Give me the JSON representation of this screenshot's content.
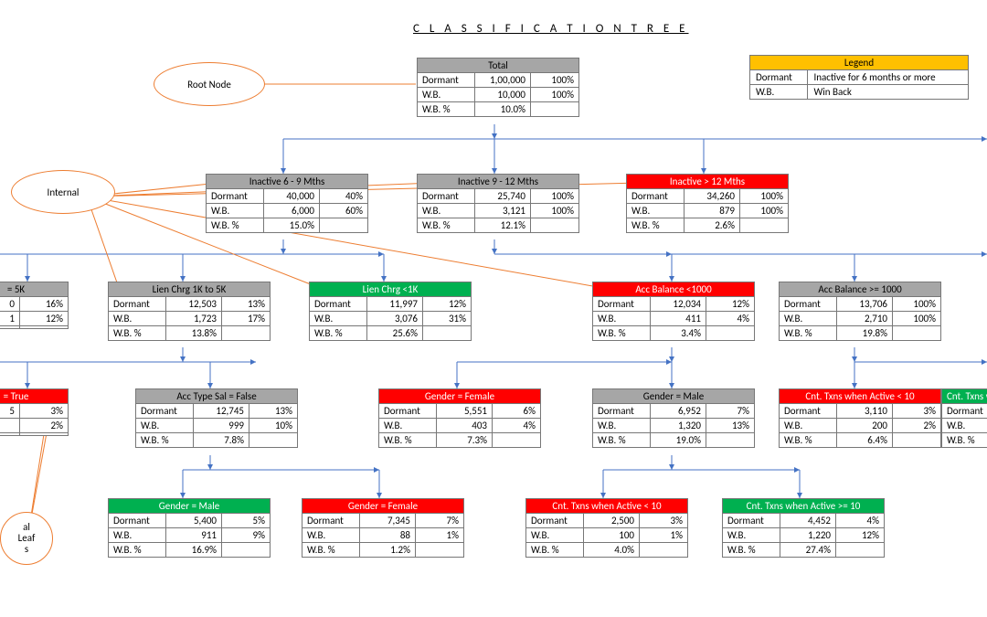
{
  "title": "C L A S S I F I C A T I O N     T R E E",
  "annot": {
    "root": "Root Node",
    "internal": "Internal",
    "leaf_a": "al",
    "leaf_b": "Leaf",
    "leaf_c": "s"
  },
  "legend": {
    "title": "Legend",
    "r1a": "Dormant",
    "r1b": "Inactive for 6 months or more",
    "r2a": "W.B.",
    "r2b": "Win Back"
  },
  "labels": {
    "dormant": "Dormant",
    "wb": "W.B.",
    "wbp": "W.B. %"
  },
  "n": {
    "total": {
      "title": "Total",
      "d": "1,00,000",
      "dp": "100%",
      "w": "10,000",
      "wp": "100%",
      "p": "10.0%"
    },
    "l1a": {
      "title": "Inactive 6 - 9 Mths",
      "d": "40,000",
      "dp": "40%",
      "w": "6,000",
      "wp": "60%",
      "p": "15.0%"
    },
    "l1b": {
      "title": "Inactive 9 - 12 Mths",
      "d": "25,740",
      "dp": "100%",
      "w": "3,121",
      "wp": "100%",
      "p": "12.1%"
    },
    "l1c": {
      "title": "Inactive > 12 Mths",
      "d": "34,260",
      "dp": "100%",
      "w": "879",
      "wp": "100%",
      "p": "2.6%"
    },
    "l2x": {
      "title": "= 5K",
      "d": "0",
      "dp": "16%",
      "w": "1",
      "wp": "12%",
      "p": ""
    },
    "l2a": {
      "title": "Lien Chrg 1K to 5K",
      "d": "12,503",
      "dp": "13%",
      "w": "1,723",
      "wp": "17%",
      "p": "13.8%"
    },
    "l2b": {
      "title": "Lien Chrg <1K",
      "d": "11,997",
      "dp": "12%",
      "w": "3,076",
      "wp": "31%",
      "p": "25.6%"
    },
    "l2c": {
      "title": "Acc Balance <1000",
      "d": "12,034",
      "dp": "12%",
      "w": "411",
      "wp": "4%",
      "p": "3.4%"
    },
    "l2d": {
      "title": "Acc Balance >= 1000",
      "d": "13,706",
      "dp": "100%",
      "w": "2,710",
      "wp": "100%",
      "p": "19.8%"
    },
    "l3x": {
      "title": "= True",
      "d": "5",
      "dp": "3%",
      "w": "",
      "wp": "2%",
      "p": ""
    },
    "l3a": {
      "title": "Acc Type Sal = False",
      "d": "12,745",
      "dp": "13%",
      "w": "999",
      "wp": "10%",
      "p": "7.8%"
    },
    "l3b": {
      "title": "Gender = Female",
      "d": "5,551",
      "dp": "6%",
      "w": "403",
      "wp": "4%",
      "p": "7.3%"
    },
    "l3c": {
      "title": "Gender = Male",
      "d": "6,952",
      "dp": "7%",
      "w": "1,320",
      "wp": "13%",
      "p": "19.0%"
    },
    "l3d": {
      "title": "Cnt. Txns when Active < 10",
      "d": "3,110",
      "dp": "3%",
      "w": "200",
      "wp": "2%",
      "p": "6.4%"
    },
    "l3e": {
      "title": "Cnt. Txns w",
      "d": "",
      "dp": "",
      "w": "",
      "wp": "",
      "p": ""
    },
    "l4a": {
      "title": "Gender = Male",
      "d": "5,400",
      "dp": "5%",
      "w": "911",
      "wp": "9%",
      "p": "16.9%"
    },
    "l4b": {
      "title": "Gender = Female",
      "d": "7,345",
      "dp": "7%",
      "w": "88",
      "wp": "1%",
      "p": "1.2%"
    },
    "l4c": {
      "title": "Cnt. Txns when Active < 10",
      "d": "2,500",
      "dp": "3%",
      "w": "100",
      "wp": "1%",
      "p": "4.0%"
    },
    "l4d": {
      "title": "Cnt. Txns when Active >= 10",
      "d": "4,452",
      "dp": "4%",
      "w": "1,220",
      "wp": "12%",
      "p": "27.4%"
    }
  }
}
